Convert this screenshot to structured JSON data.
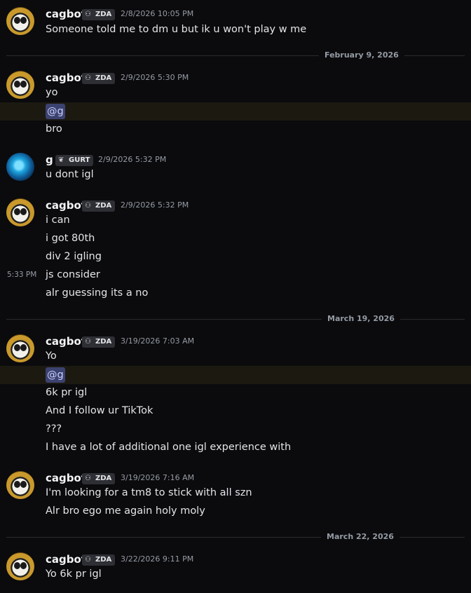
{
  "users": {
    "cagbot": {
      "name": "cagbot",
      "tag": "ZDA",
      "tag_icon": "guild-tag-icon"
    },
    "g": {
      "name": "g",
      "tag": "GURT",
      "tag_icon": "leaf-tag-icon"
    }
  },
  "dividers": [
    "February 9, 2026",
    "March 19, 2026",
    "March 22, 2026"
  ],
  "messages": [
    {
      "user": "cagbot",
      "time": "2/8/2026 10:05 PM",
      "lines": [
        "Someone told me to dm u but ik u won't play w me"
      ]
    },
    {
      "user": "cagbot",
      "time": "2/9/2026 5:30 PM",
      "lines": [
        "yo",
        "@g",
        "bro"
      ]
    },
    {
      "user": "g",
      "time": "2/9/2026 5:32 PM",
      "lines": [
        "u dont igl"
      ]
    },
    {
      "user": "cagbot",
      "time": "2/9/2026 5:32 PM",
      "lines": [
        "i can",
        "i got 80th",
        "div 2 igling",
        "js consider",
        "alr guessing its a no"
      ],
      "hover_time": "5:33 PM"
    },
    {
      "user": "cagbot",
      "time": "3/19/2026 7:03 AM",
      "lines": [
        "Yo",
        "@g",
        "6k pr igl",
        "And I follow ur TikTok",
        "???",
        "I have a lot of additional one igl experience with"
      ]
    },
    {
      "user": "cagbot",
      "time": "3/19/2026 7:16 AM",
      "lines": [
        "I'm looking for a tm8 to stick with all szn",
        "Alr bro ego me again holy moly"
      ]
    },
    {
      "user": "cagbot",
      "time": "3/22/2026 9:11 PM",
      "lines": [
        "Yo 6k pr igl"
      ]
    }
  ]
}
